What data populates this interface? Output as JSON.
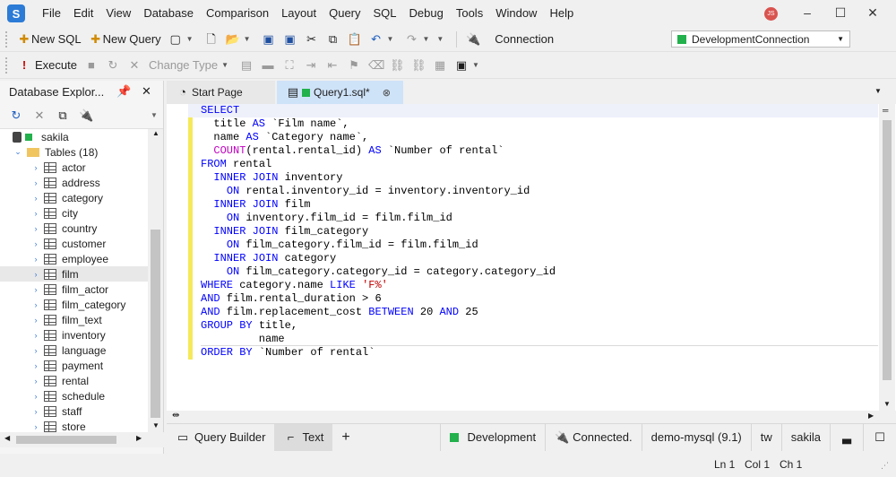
{
  "app": {
    "logo_letter": "S",
    "user_initials": "JS"
  },
  "menu": [
    "File",
    "Edit",
    "View",
    "Database",
    "Comparison",
    "Layout",
    "Query",
    "SQL",
    "Debug",
    "Tools",
    "Window",
    "Help"
  ],
  "toolbar1": {
    "new_sql": "New SQL",
    "new_query": "New Query",
    "connection_label": "Connection",
    "connection_value": "DevelopmentConnection"
  },
  "toolbar2": {
    "execute": "Execute",
    "change_type": "Change Type"
  },
  "explorer": {
    "title": "Database Explor...",
    "database": "sakila",
    "tables_group": "Tables (18)",
    "tables": [
      "actor",
      "address",
      "category",
      "city",
      "country",
      "customer",
      "employee",
      "film",
      "film_actor",
      "film_category",
      "film_text",
      "inventory",
      "language",
      "payment",
      "rental",
      "schedule",
      "staff",
      "store"
    ],
    "selected": "film"
  },
  "tabs": [
    {
      "label": "Start Page"
    },
    {
      "label": "Query1.sql*"
    }
  ],
  "sql_lines": [
    "SELECT",
    "  title AS `Film name`,",
    "  name AS `Category name`,",
    "  COUNT(rental.rental_id) AS `Number of rental`",
    "FROM rental",
    "  INNER JOIN inventory",
    "    ON rental.inventory_id = inventory.inventory_id",
    "  INNER JOIN film",
    "    ON inventory.film_id = film.film_id",
    "  INNER JOIN film_category",
    "    ON film_category.film_id = film.film_id",
    "  INNER JOIN category",
    "    ON film_category.category_id = category.category_id",
    "WHERE category.name LIKE 'F%'",
    "AND film.rental_duration > 6",
    "AND film.replacement_cost BETWEEN 20 AND 25",
    "GROUP BY title,",
    "         name",
    "ORDER BY `Number of rental`"
  ],
  "editor_bar": {
    "query_builder": "Query Builder",
    "text": "Text",
    "add": "+",
    "env": "Development",
    "conn_state": "Connected.",
    "server": "demo-mysql (9.1)",
    "user": "tw",
    "db": "sakila"
  },
  "status": {
    "ln": "Ln 1",
    "col": "Col 1",
    "ch": "Ch 1"
  },
  "colors": {
    "keyword": "#0000ff",
    "function": "#c000c0",
    "string": "#c00000",
    "accent": "#2c7bd6",
    "env_green": "#22b14c"
  }
}
